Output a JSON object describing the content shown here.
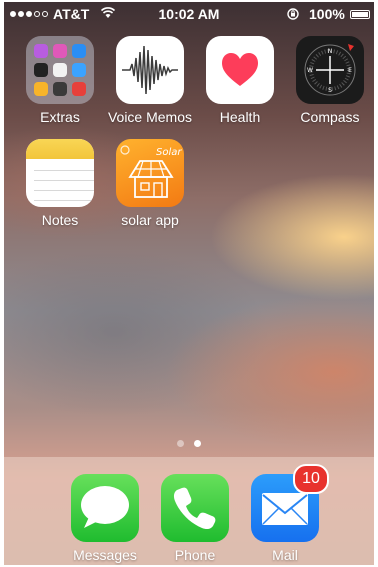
{
  "status_bar": {
    "carrier": "AT&T",
    "time": "10:02 AM",
    "battery": "100%",
    "signal_bars_filled": 3,
    "signal_bars_total": 5
  },
  "home_apps": [
    {
      "name": "Extras",
      "icon": "folder-icon"
    },
    {
      "name": "Voice Memos",
      "icon": "voice-memos-icon"
    },
    {
      "name": "Health",
      "icon": "health-heart-icon"
    },
    {
      "name": "Compass",
      "icon": "compass-icon"
    },
    {
      "name": "Notes",
      "icon": "notes-icon"
    },
    {
      "name": "solar app",
      "icon": "solar-house-icon",
      "icon_text": "Solar"
    }
  ],
  "page_indicator": {
    "pages": 2,
    "current": 2
  },
  "dock": [
    {
      "name": "Messages",
      "icon": "messages-bubble-icon"
    },
    {
      "name": "Phone",
      "icon": "phone-handset-icon"
    },
    {
      "name": "Mail",
      "icon": "mail-envelope-icon",
      "badge": "10"
    }
  ],
  "colors": {
    "badge": "#e8322d",
    "notes_yellow": "#f2c53a",
    "health_heart": "#fd3d5a",
    "solar_orange": "#f37a13",
    "mail_blue": "#1670ef",
    "phone_green": "#1fbc2f"
  }
}
